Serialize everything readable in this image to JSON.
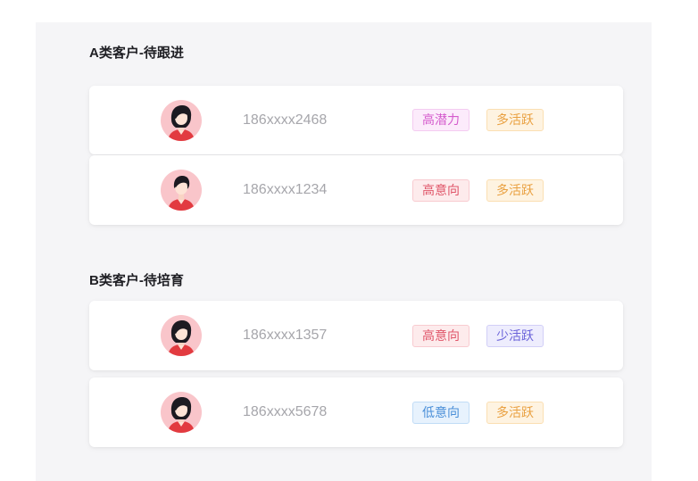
{
  "sections": [
    {
      "title": "A类客户-待跟进",
      "customers": [
        {
          "avatar_icon": "avatar-woman-icon",
          "phone": "186xxxx2468",
          "tags": [
            {
              "label": "高潜力",
              "color": "#d45bcd",
              "bg": "#fcebfb",
              "border": "#f4cbf1"
            },
            {
              "label": "多活跃",
              "color": "#e9a040",
              "bg": "#fef3e1",
              "border": "#fbdfb2"
            }
          ]
        },
        {
          "avatar_icon": "avatar-woman-icon",
          "phone": "186xxxx1234",
          "tags": [
            {
              "label": "高意向",
              "color": "#e0566a",
              "bg": "#fdebec",
              "border": "#f8cbd0"
            },
            {
              "label": "多活跃",
              "color": "#e9a040",
              "bg": "#fef3e1",
              "border": "#fbdfb2"
            }
          ]
        }
      ]
    },
    {
      "title": "B类客户-待培育",
      "customers": [
        {
          "avatar_icon": "avatar-woman-icon",
          "phone": "186xxxx1357",
          "tags": [
            {
              "label": "高意向",
              "color": "#e0566a",
              "bg": "#fdebec",
              "border": "#f8cbd0"
            },
            {
              "label": "少活跃",
              "color": "#6a62d9",
              "bg": "#eeedfd",
              "border": "#d2cff7"
            }
          ]
        },
        {
          "avatar_icon": "avatar-woman-icon",
          "phone": "186xxxx5678",
          "tags": [
            {
              "label": "低意向",
              "color": "#4a8fd8",
              "bg": "#e7f2fd",
              "border": "#c0dcf6"
            },
            {
              "label": "多活跃",
              "color": "#e9a040",
              "bg": "#fef3e1",
              "border": "#fbdfb2"
            }
          ]
        }
      ]
    }
  ]
}
